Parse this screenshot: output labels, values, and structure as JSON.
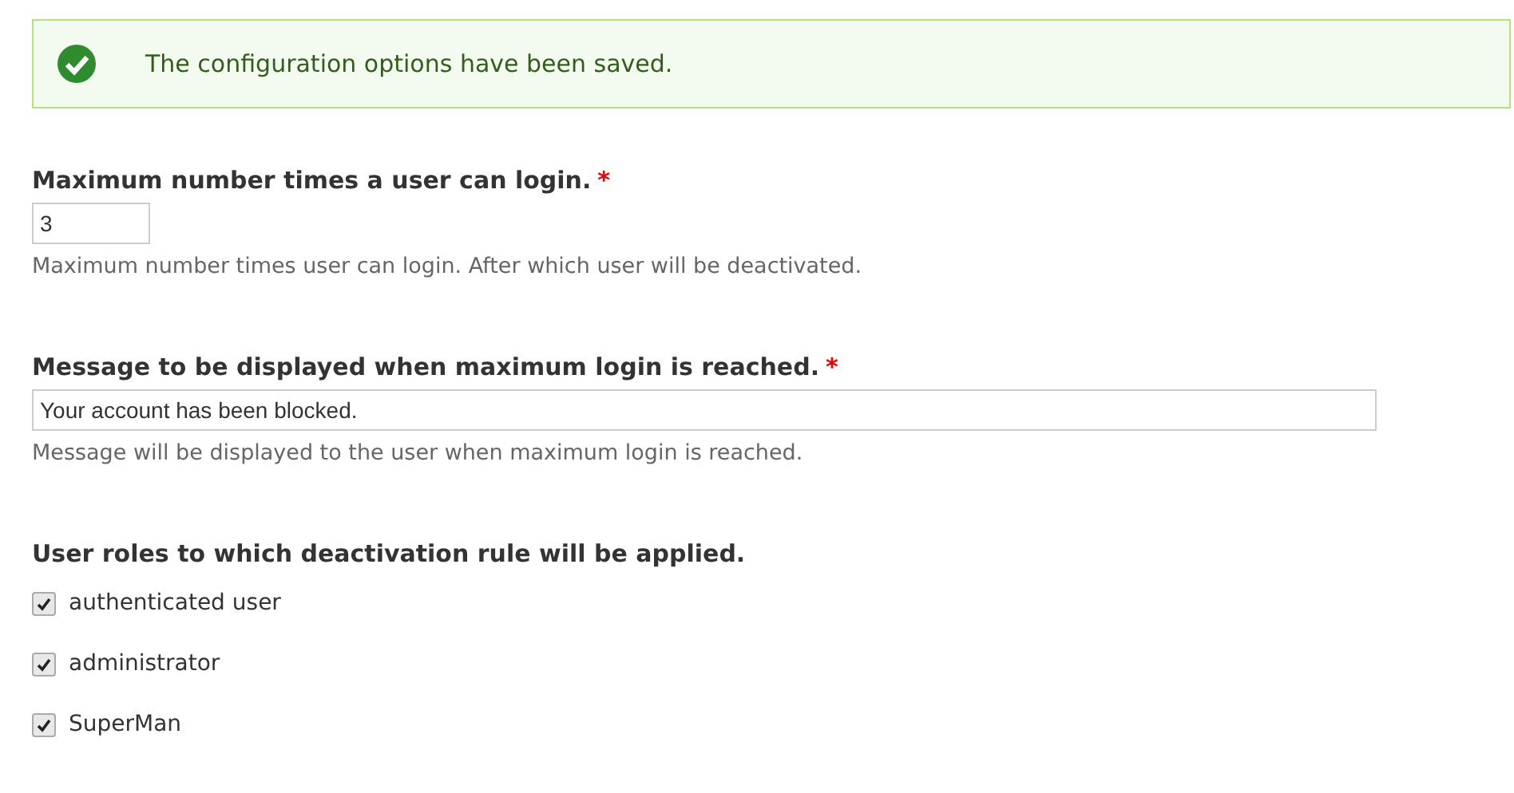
{
  "status_message": {
    "kind": "success",
    "text": "The configuration options have been saved."
  },
  "fields": [
    {
      "kind": "number",
      "label": "Maximum number times a user can login.",
      "required_mark": "*",
      "value": "3",
      "description": "Maximum number times user can login. After which user will be deactivated."
    },
    {
      "kind": "text",
      "label": "Message to be displayed when maximum login is reached.",
      "required_mark": "*",
      "value": "Your account has been blocked.",
      "description": "Message will be displayed to the user when maximum login is reached."
    },
    {
      "kind": "checkboxes",
      "label": "User roles to which deactivation rule will be applied.",
      "options": [
        {
          "label": "authenticated user",
          "checked": true
        },
        {
          "label": "administrator",
          "checked": true
        },
        {
          "label": "SuperMan",
          "checked": true
        }
      ]
    }
  ]
}
